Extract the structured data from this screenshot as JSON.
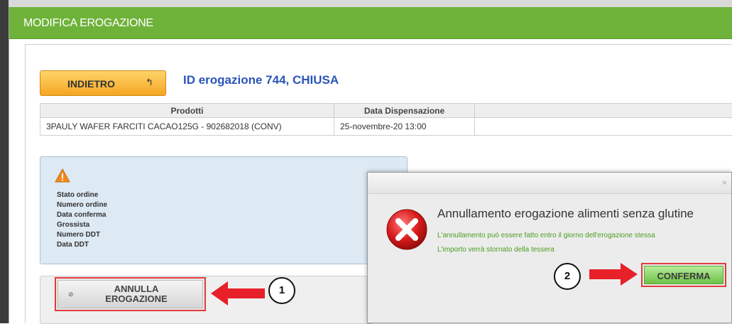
{
  "window": {
    "title": "MODIFICA EROGAZIONE"
  },
  "header": {
    "back_label": "INDIETRO",
    "back_icon": "back-arrow-icon",
    "id_title": "ID erogazione 744,   CHIUSA"
  },
  "table": {
    "columns": [
      "Prodotti",
      "Data Dispensazione",
      ""
    ],
    "rows": [
      {
        "prodotto": "3PAULY WAFER FARCITI CACAO125G - 902682018  (CONV)",
        "data": "25-novembre-20 13:00",
        "extra": ""
      }
    ]
  },
  "info": {
    "icon": "warning-icon",
    "labels": [
      "Stato ordine",
      "Numero ordine",
      "Data conferma",
      "Grossista",
      "Numero DDT",
      "Data DDT"
    ]
  },
  "actions": {
    "annulla_label_line1": "ANNULLA",
    "annulla_label_line2": "EROGAZIONE",
    "annulla_icon": "ban-icon"
  },
  "dialog": {
    "close": "×",
    "title": "Annullamento erogazione alimenti senza glutine",
    "line1": "L'annullamento può essere fatto entro il giorno dell'erogazione stessa",
    "line2": "L'importo verrà stornato della tessera",
    "confirm_label": "CONFERMA"
  },
  "annotations": {
    "step1": "1",
    "step2": "2"
  },
  "colors": {
    "header_green": "#6fb23a",
    "accent_blue": "#2a55b8",
    "highlight_red": "#e23b3b",
    "note_green": "#4b9d21"
  }
}
